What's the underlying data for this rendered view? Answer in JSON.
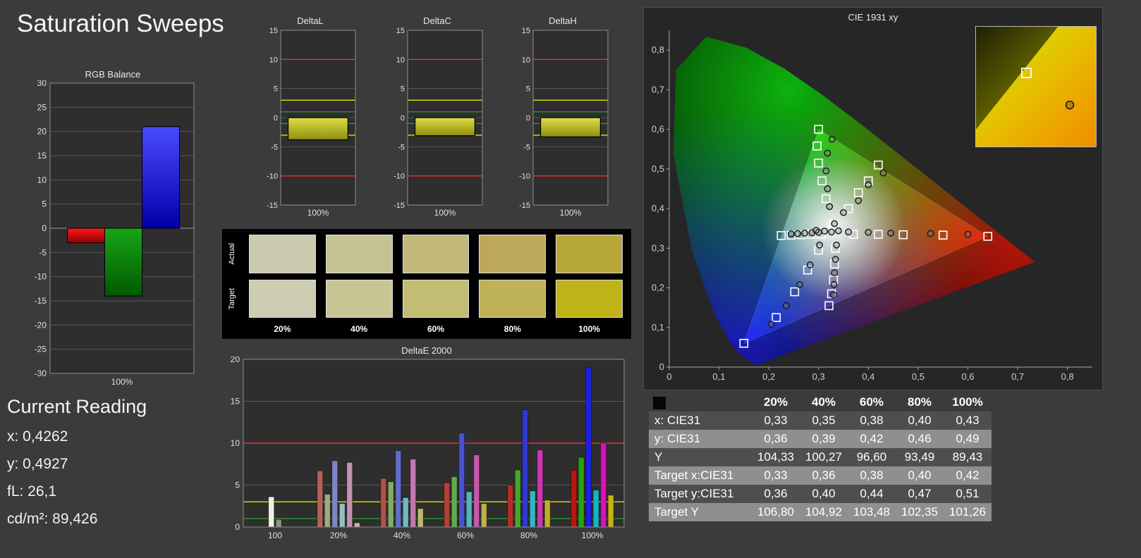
{
  "app": {
    "title": "Saturation Sweeps"
  },
  "current_reading": {
    "title": "Current Reading",
    "lines": [
      "x: 0,4262",
      "y: 0,4927",
      "fL: 26,1",
      "cd/m²: 89,426"
    ]
  },
  "rgb_balance": {
    "title": "RGB Balance",
    "x_label": "100%",
    "axis": {
      "min": -30,
      "max": 30,
      "step": 5
    },
    "bars": [
      {
        "name": "red",
        "value": -3,
        "top": "#ff1a1a",
        "bottom": "#8f0000"
      },
      {
        "name": "green",
        "value": -14,
        "top": "#17a617",
        "bottom": "#005a00"
      },
      {
        "name": "blue",
        "value": 21,
        "top": "#4a4aff",
        "bottom": "#0000a8"
      }
    ]
  },
  "delta_charts": {
    "x_label": "100%",
    "axis": {
      "min": -15,
      "max": 15,
      "step": 5
    },
    "ref_lines": [
      {
        "v": 10,
        "c": "#e8312b"
      },
      {
        "v": -10,
        "c": "#e8312b"
      },
      {
        "v": 3,
        "c": "#e8e000"
      },
      {
        "v": -3,
        "c": "#e8e000"
      },
      {
        "v": 1,
        "c": "#1e9e1e"
      },
      {
        "v": -1,
        "c": "#1e9e1e"
      }
    ],
    "bar_top": "#dede45",
    "bar_bottom": "#8f8f0f",
    "charts": [
      {
        "title": "DeltaL",
        "value": -3.8
      },
      {
        "title": "DeltaC",
        "value": -3.1
      },
      {
        "title": "DeltaH",
        "value": -3.3
      }
    ]
  },
  "swatches": {
    "row_labels": [
      "Actual",
      "Target"
    ],
    "columns": [
      "20%",
      "40%",
      "60%",
      "80%",
      "100%"
    ],
    "actual": [
      "#cccab1",
      "#c6c293",
      "#c1b87a",
      "#bda75d",
      "#b7a739"
    ],
    "target": [
      "#ceccb3",
      "#c9c695",
      "#c3bd74",
      "#beb156",
      "#bfb318"
    ]
  },
  "deltae": {
    "title": "DeltaE 2000",
    "axis": {
      "min": 0,
      "max": 20,
      "step": 5
    },
    "ref_lines": [
      {
        "v": 10,
        "c": "#e8312b"
      },
      {
        "v": 3,
        "c": "#e8e000"
      },
      {
        "v": 1,
        "c": "#1e9e1e"
      }
    ],
    "groups": [
      {
        "label": "100",
        "bars": [
          {
            "value": 3.6,
            "color": "#efefe2"
          },
          {
            "value": 0.9,
            "color": "#8f8f8f"
          }
        ]
      },
      {
        "label": "20%",
        "bars": [
          {
            "value": 6.7,
            "color": "#b2625a"
          },
          {
            "value": 3.9,
            "color": "#9dac83"
          },
          {
            "value": 7.9,
            "color": "#7e85c7"
          },
          {
            "value": 2.8,
            "color": "#94bcc3"
          },
          {
            "value": 7.7,
            "color": "#c591b1"
          },
          {
            "value": 0.5,
            "color": "#bfbf93"
          }
        ]
      },
      {
        "label": "40%",
        "bars": [
          {
            "value": 5.8,
            "color": "#b25049"
          },
          {
            "value": 5.4,
            "color": "#81ab67"
          },
          {
            "value": 9.1,
            "color": "#646cc9"
          },
          {
            "value": 3.5,
            "color": "#73b7c1"
          },
          {
            "value": 8.1,
            "color": "#c377ae"
          },
          {
            "value": 2.2,
            "color": "#bdb871"
          }
        ]
      },
      {
        "label": "60%",
        "bars": [
          {
            "value": 5.3,
            "color": "#b33f37"
          },
          {
            "value": 6.0,
            "color": "#63a94d"
          },
          {
            "value": 11.2,
            "color": "#4a52cd"
          },
          {
            "value": 4.2,
            "color": "#55b3c3"
          },
          {
            "value": 8.6,
            "color": "#c757ac"
          },
          {
            "value": 2.8,
            "color": "#bdb04f"
          }
        ]
      },
      {
        "label": "80%",
        "bars": [
          {
            "value": 5.0,
            "color": "#b52d25"
          },
          {
            "value": 6.8,
            "color": "#45a72e"
          },
          {
            "value": 14.0,
            "color": "#3138d3"
          },
          {
            "value": 4.3,
            "color": "#37b2c5"
          },
          {
            "value": 9.2,
            "color": "#cc36b1"
          },
          {
            "value": 3.2,
            "color": "#c1ae2b"
          }
        ]
      },
      {
        "label": "100%",
        "bars": [
          {
            "value": 6.8,
            "color": "#bc1410"
          },
          {
            "value": 8.3,
            "color": "#26a60e"
          },
          {
            "value": 19.0,
            "color": "#1e22de"
          },
          {
            "value": 4.4,
            "color": "#16b2c9"
          },
          {
            "value": 10.0,
            "color": "#d713b9"
          },
          {
            "value": 3.8,
            "color": "#c5b312"
          }
        ]
      }
    ]
  },
  "cie": {
    "title": "CIE 1931 xy",
    "max": 0.85,
    "tick_labels": [
      "0",
      "0,1",
      "0,2",
      "0,3",
      "0,4",
      "0,5",
      "0,6",
      "0,7",
      "0,8"
    ],
    "gamut_triangle": [
      [
        0.64,
        0.33
      ],
      [
        0.3,
        0.6
      ],
      [
        0.15,
        0.06
      ]
    ],
    "targets": [
      [
        0.33,
        0.36
      ],
      [
        0.36,
        0.4
      ],
      [
        0.38,
        0.44
      ],
      [
        0.4,
        0.47
      ],
      [
        0.42,
        0.51
      ],
      [
        0.37,
        0.335
      ],
      [
        0.42,
        0.335
      ],
      [
        0.47,
        0.334
      ],
      [
        0.55,
        0.333
      ],
      [
        0.64,
        0.33
      ],
      [
        0.315,
        0.425
      ],
      [
        0.307,
        0.47
      ],
      [
        0.3,
        0.515
      ],
      [
        0.297,
        0.558
      ],
      [
        0.3,
        0.6
      ],
      [
        0.305,
        0.335
      ],
      [
        0.285,
        0.335
      ],
      [
        0.265,
        0.334
      ],
      [
        0.245,
        0.333
      ],
      [
        0.225,
        0.332
      ],
      [
        0.3,
        0.295
      ],
      [
        0.278,
        0.245
      ],
      [
        0.252,
        0.19
      ],
      [
        0.215,
        0.125
      ],
      [
        0.15,
        0.06
      ],
      [
        0.334,
        0.3
      ],
      [
        0.332,
        0.26
      ],
      [
        0.33,
        0.22
      ],
      [
        0.326,
        0.185
      ],
      [
        0.321,
        0.155
      ]
    ],
    "measurements": [
      [
        0.332,
        0.362
      ],
      [
        0.35,
        0.39
      ],
      [
        0.38,
        0.42
      ],
      [
        0.4,
        0.46
      ],
      [
        0.43,
        0.49
      ],
      [
        0.36,
        0.341
      ],
      [
        0.4,
        0.34
      ],
      [
        0.445,
        0.338
      ],
      [
        0.525,
        0.337
      ],
      [
        0.6,
        0.335
      ],
      [
        0.322,
        0.405
      ],
      [
        0.318,
        0.45
      ],
      [
        0.315,
        0.495
      ],
      [
        0.318,
        0.54
      ],
      [
        0.327,
        0.575
      ],
      [
        0.3,
        0.34
      ],
      [
        0.287,
        0.339
      ],
      [
        0.272,
        0.338
      ],
      [
        0.258,
        0.337
      ],
      [
        0.245,
        0.336
      ],
      [
        0.302,
        0.308
      ],
      [
        0.283,
        0.258
      ],
      [
        0.262,
        0.208
      ],
      [
        0.235,
        0.155
      ],
      [
        0.205,
        0.108
      ],
      [
        0.336,
        0.308
      ],
      [
        0.334,
        0.272
      ],
      [
        0.332,
        0.238
      ],
      [
        0.331,
        0.208
      ],
      [
        0.33,
        0.182
      ],
      [
        0.295,
        0.345
      ],
      [
        0.312,
        0.343
      ],
      [
        0.326,
        0.341
      ],
      [
        0.34,
        0.344
      ]
    ],
    "inset": {
      "target": [
        0.42,
        0.51
      ],
      "measured": [
        0.43,
        0.49
      ]
    }
  },
  "table": {
    "columns": [
      "20%",
      "40%",
      "60%",
      "80%",
      "100%"
    ],
    "rows": [
      {
        "label": "x: CIE31",
        "values": [
          "0,33",
          "0,35",
          "0,38",
          "0,40",
          "0,43"
        ]
      },
      {
        "label": "y: CIE31",
        "values": [
          "0,36",
          "0,39",
          "0,42",
          "0,46",
          "0,49"
        ]
      },
      {
        "label": "Y",
        "values": [
          "104,33",
          "100,27",
          "96,60",
          "93,49",
          "89,43"
        ]
      },
      {
        "label": "Target x:CIE31",
        "values": [
          "0,33",
          "0,36",
          "0,38",
          "0,40",
          "0,42"
        ]
      },
      {
        "label": "Target y:CIE31",
        "values": [
          "0,36",
          "0,40",
          "0,44",
          "0,47",
          "0,51"
        ]
      },
      {
        "label": "Target Y",
        "values": [
          "106,80",
          "104,92",
          "103,48",
          "102,35",
          "101,26"
        ]
      }
    ]
  },
  "chart_data": [
    {
      "type": "bar",
      "title": "RGB Balance",
      "categories": [
        "Red",
        "Green",
        "Blue"
      ],
      "values": [
        -3,
        -14,
        21
      ],
      "xlabel": "100%",
      "ylim": [
        -30,
        30
      ]
    },
    {
      "type": "bar",
      "title": "DeltaL",
      "categories": [
        "100%"
      ],
      "values": [
        -3.8
      ],
      "ylim": [
        -15,
        15
      ],
      "ref_lines": [
        -10,
        -3,
        -1,
        1,
        3,
        10
      ]
    },
    {
      "type": "bar",
      "title": "DeltaC",
      "categories": [
        "100%"
      ],
      "values": [
        -3.1
      ],
      "ylim": [
        -15,
        15
      ],
      "ref_lines": [
        -10,
        -3,
        -1,
        1,
        3,
        10
      ]
    },
    {
      "type": "bar",
      "title": "DeltaH",
      "categories": [
        "100%"
      ],
      "values": [
        -3.3
      ],
      "ylim": [
        -15,
        15
      ],
      "ref_lines": [
        -10,
        -3,
        -1,
        1,
        3,
        10
      ]
    },
    {
      "type": "bar",
      "title": "DeltaE 2000",
      "categories": [
        "100",
        "20%",
        "40%",
        "60%",
        "80%",
        "100%"
      ],
      "ylim": [
        0,
        20
      ],
      "ref_lines": [
        1,
        3,
        10
      ],
      "series": [
        {
          "name": "white",
          "values": [
            3.6,
            null,
            null,
            null,
            null,
            null
          ]
        },
        {
          "name": "gray",
          "values": [
            0.9,
            null,
            null,
            null,
            null,
            null
          ]
        },
        {
          "name": "red",
          "values": [
            null,
            6.7,
            5.8,
            5.3,
            5.0,
            6.8
          ]
        },
        {
          "name": "green",
          "values": [
            null,
            3.9,
            5.4,
            6.0,
            6.8,
            8.3
          ]
        },
        {
          "name": "blue",
          "values": [
            null,
            7.9,
            9.1,
            11.2,
            14.0,
            19.0
          ]
        },
        {
          "name": "cyan",
          "values": [
            null,
            2.8,
            3.5,
            4.2,
            4.3,
            4.4
          ]
        },
        {
          "name": "magenta",
          "values": [
            null,
            7.7,
            8.1,
            8.6,
            9.2,
            10.0
          ]
        },
        {
          "name": "yellow",
          "values": [
            null,
            0.5,
            2.2,
            2.8,
            3.2,
            3.8
          ]
        }
      ]
    },
    {
      "type": "scatter",
      "title": "CIE 1931 xy",
      "xlim": [
        0,
        0.8
      ],
      "ylim": [
        0,
        0.8
      ],
      "series": [
        {
          "name": "target",
          "marker": "square",
          "points": [
            [
              0.33,
              0.36
            ],
            [
              0.36,
              0.4
            ],
            [
              0.38,
              0.44
            ],
            [
              0.4,
              0.47
            ],
            [
              0.42,
              0.51
            ]
          ]
        },
        {
          "name": "measured",
          "marker": "circle",
          "points": [
            [
              0.33,
              0.36
            ],
            [
              0.35,
              0.39
            ],
            [
              0.38,
              0.42
            ],
            [
              0.4,
              0.46
            ],
            [
              0.43,
              0.49
            ]
          ]
        }
      ]
    },
    {
      "type": "table",
      "title": "Saturation sweep values",
      "categories": [
        "20%",
        "40%",
        "60%",
        "80%",
        "100%"
      ],
      "series": [
        {
          "name": "x: CIE31",
          "values": [
            0.33,
            0.35,
            0.38,
            0.4,
            0.43
          ]
        },
        {
          "name": "y: CIE31",
          "values": [
            0.36,
            0.39,
            0.42,
            0.46,
            0.49
          ]
        },
        {
          "name": "Y",
          "values": [
            104.33,
            100.27,
            96.6,
            93.49,
            89.43
          ]
        },
        {
          "name": "Target x:CIE31",
          "values": [
            0.33,
            0.36,
            0.38,
            0.4,
            0.42
          ]
        },
        {
          "name": "Target y:CIE31",
          "values": [
            0.36,
            0.4,
            0.44,
            0.47,
            0.51
          ]
        },
        {
          "name": "Target Y",
          "values": [
            106.8,
            104.92,
            103.48,
            102.35,
            101.26
          ]
        }
      ]
    }
  ]
}
